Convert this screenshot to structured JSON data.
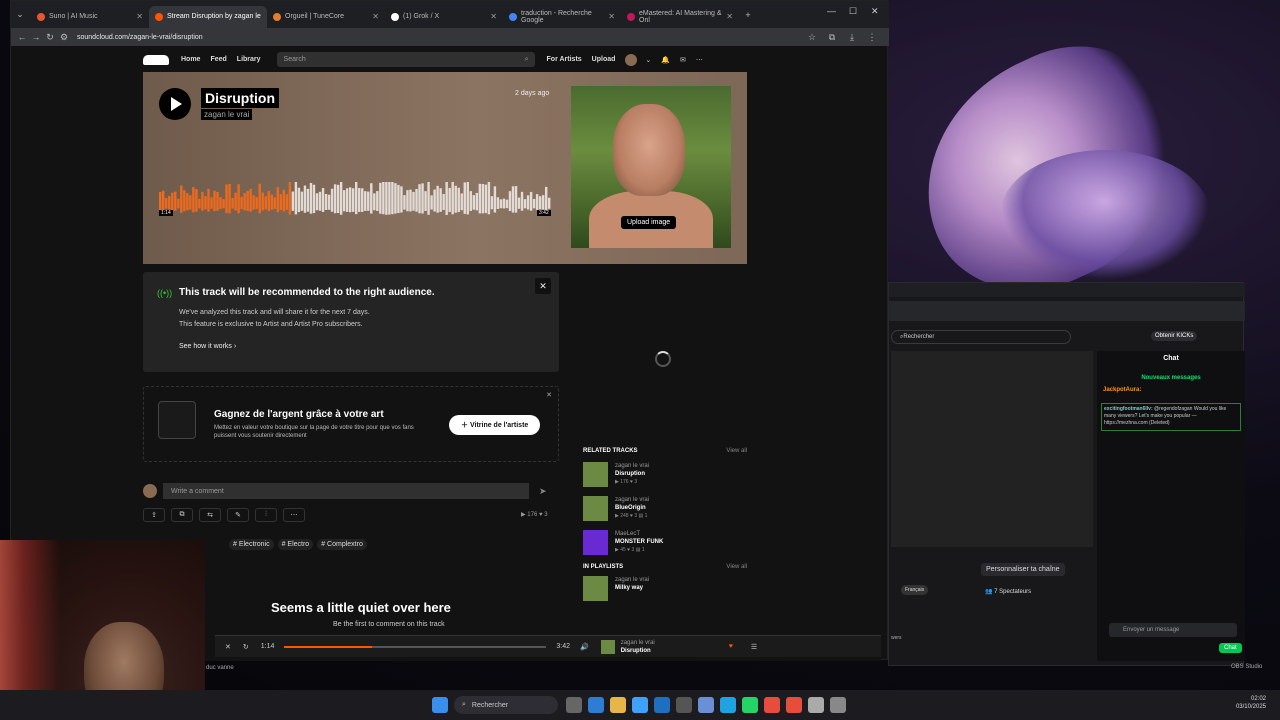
{
  "tabs": [
    {
      "label": "Suno | AI Music",
      "color": "#e8572f"
    },
    {
      "label": "Stream Disruption by zagan le",
      "color": "#f50"
    },
    {
      "label": "Orgueil | TuneCore",
      "color": "#e57c2e"
    },
    {
      "label": "(1) Grok / X",
      "color": "#ffffff"
    },
    {
      "label": "traduction - Recherche Google",
      "color": "#4285f4"
    },
    {
      "label": "eMastered: AI Mastering & Onl",
      "color": "#c2185b"
    }
  ],
  "address": {
    "url": "soundcloud.com/zagan-le-vrai/disruption"
  },
  "nav": {
    "home": "Home",
    "feed": "Feed",
    "library": "Library",
    "search_placeholder": "Search",
    "for_artists": "For Artists",
    "upload": "Upload"
  },
  "track": {
    "title": "Disruption",
    "artist": "zagan le vrai",
    "date": "2 days ago",
    "elapsed": "1:14",
    "duration": "3:42",
    "progress": 0.333,
    "upload_image": "Upload image"
  },
  "reco": {
    "title": "This track will be recommended to the right audience.",
    "line1": "We've analyzed this track and will share it for the next 7 days.",
    "line2": "This feature is exclusive to Artist and Artist Pro subscribers.",
    "link": "See how it works"
  },
  "promo": {
    "title": "Gagnez de l'argent grâce à votre art",
    "desc": "Mettez en valeur votre boutique sur la page de votre titre pour que vos fans puissent vous soutenir directement",
    "button": "Vitrine de l'artiste"
  },
  "comment": {
    "placeholder": "Write a comment"
  },
  "stats": {
    "plays": "176",
    "likes": "3"
  },
  "tags": [
    "# Electronic",
    "# Electro",
    "# Complextro"
  ],
  "empty": {
    "title": "Seems a little quiet over here",
    "subtitle": "Be the first to comment on this track"
  },
  "related": {
    "heading": "RELATED TRACKS",
    "view_all": "View all",
    "items": [
      {
        "artist": "zagan le vrai",
        "title": "Disruption",
        "stats": "▶ 176   ♥ 3"
      },
      {
        "artist": "zagan le vrai",
        "title": "BlueOrigin",
        "stats": "▶ 248   ♥ 3   ▤ 1"
      },
      {
        "artist": "MaeLecT",
        "title": "MONSTER FUNK",
        "stats": "▶ 45   ♥ 3   ▤ 1"
      }
    ]
  },
  "playlists": {
    "heading": "IN PLAYLISTS",
    "view_all": "View all",
    "artist": "zagan le vrai",
    "title": "Milky way"
  },
  "player": {
    "artist": "zagan le vrai",
    "title": "Disruption"
  },
  "twitch": {
    "search": "Rechercher",
    "kicks": "Obtenir KICKs",
    "chat_title": "Chat",
    "new_messages": "Nouveaux messages",
    "user": "JackpotAura:",
    "message_user": "excitingfootman6llv:",
    "message": "@regendofzagan Would you like many viewers? Let's make you popular — https://mezhna.com",
    "message_tag": "(Deleted)",
    "input": "Envoyer un message",
    "chat_button": "Chat",
    "customize": "Personnaliser ta chaîne",
    "viewers": "7 Spectateurs",
    "lang": "Français",
    "viewers_label": "wers"
  },
  "taskbar": {
    "search": "Rechercher",
    "time": "02:02",
    "date": "03/10/2025"
  },
  "obs_label": "OBS Studio",
  "cam_label": "duc vanne"
}
